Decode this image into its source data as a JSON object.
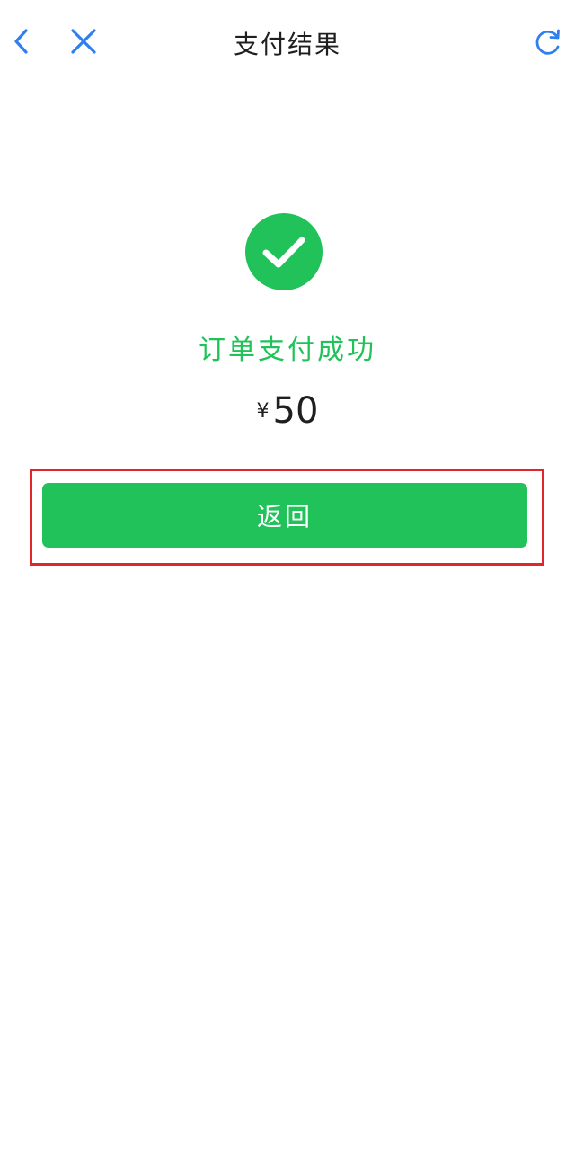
{
  "nav": {
    "title": "支付结果",
    "back_icon": "chevron-left-icon",
    "close_icon": "close-icon",
    "refresh_icon": "refresh-icon"
  },
  "result": {
    "icon": "check-circle-icon",
    "status_text": "订单支付成功",
    "currency_symbol": "¥",
    "amount": "50"
  },
  "actions": {
    "back_label": "返回"
  },
  "colors": {
    "accent_blue": "#2f7ff0",
    "success_green": "#22c25a",
    "highlight_red": "#e0262c",
    "text_dark": "#1f1f1f"
  }
}
